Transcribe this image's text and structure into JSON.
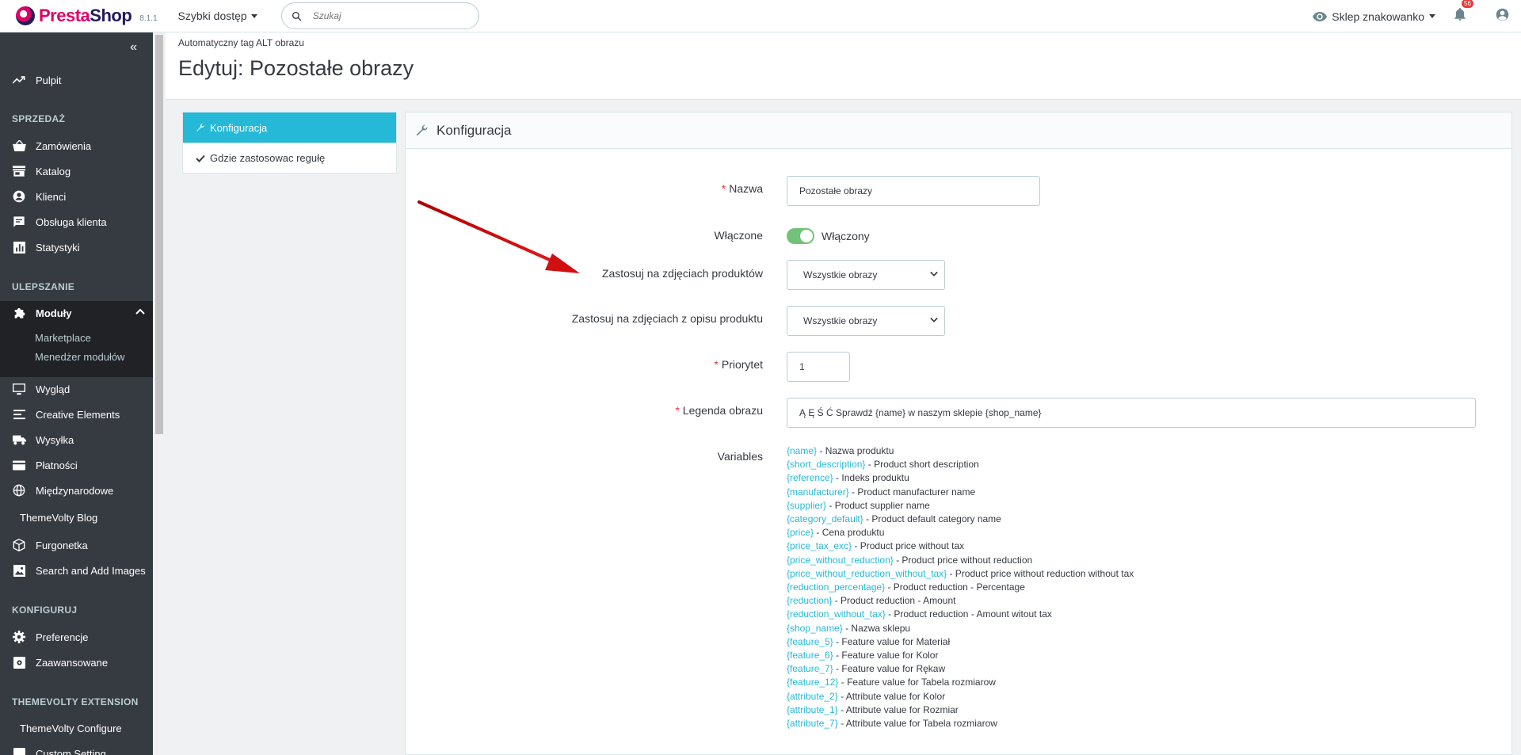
{
  "header": {
    "brand_part1": "Presta",
    "brand_part2": "Shop",
    "version": "8.1.1",
    "quick_access": "Szybki dostęp",
    "search_placeholder": "Szukaj",
    "shop_link": "Sklep znakowanko",
    "notifications_count": "56"
  },
  "sidebar": {
    "items": [
      {
        "label": "Pulpit",
        "icon": "trending-up-icon"
      },
      {
        "label": "Zamówienia",
        "icon": "basket-icon"
      },
      {
        "label": "Katalog",
        "icon": "store-icon"
      },
      {
        "label": "Klienci",
        "icon": "account-circle-icon"
      },
      {
        "label": "Obsługa klienta",
        "icon": "chat-icon"
      },
      {
        "label": "Statystyki",
        "icon": "bar-chart-icon"
      },
      {
        "label": "Moduły",
        "icon": "puzzle-icon"
      },
      {
        "label": "Wygląd",
        "icon": "desktop-icon"
      },
      {
        "label": "Creative Elements",
        "icon": "elements-icon"
      },
      {
        "label": "Wysyłka",
        "icon": "truck-icon"
      },
      {
        "label": "Płatności",
        "icon": "credit-card-icon"
      },
      {
        "label": "Międzynarodowe",
        "icon": "globe-icon"
      },
      {
        "label": "ThemeVolty Blog",
        "icon": ""
      },
      {
        "label": "Furgonetka",
        "icon": "box-icon"
      },
      {
        "label": "Search and Add Images",
        "icon": "image-icon"
      },
      {
        "label": "Preferencje",
        "icon": "gear-icon"
      },
      {
        "label": "Zaawansowane",
        "icon": "settings-box-icon"
      },
      {
        "label": "ThemeVolty Configure",
        "icon": ""
      },
      {
        "label": "Custom Setting",
        "icon": "custom-icon"
      }
    ],
    "sections": [
      "SPRZEDAŻ",
      "ULEPSZANIE",
      "KONFIGURUJ",
      "THEMEVOLTY EXTENSION"
    ],
    "module_sub": [
      "Marketplace",
      "Menedżer modułów"
    ]
  },
  "page": {
    "breadcrumb": "Automatyczny tag ALT obrazu",
    "title": "Edytuj: Pozostałe obrazy"
  },
  "tabs": [
    {
      "label": "Konfiguracja"
    },
    {
      "label": "Gdzie zastosowac regułę"
    }
  ],
  "panel": {
    "title": "Konfiguracja",
    "fields": {
      "name_label": "Nazwa",
      "name_value": "Pozostałe obrazy",
      "enabled_label": "Włączone",
      "enabled_value": "Włączony",
      "apply_products_label": "Zastosuj na zdjęciach produktów",
      "apply_products_value": "Wszystkie obrazy",
      "apply_desc_label": "Zastosuj na zdjęciach z opisu produktu",
      "apply_desc_value": "Wszystkie obrazy",
      "priority_label": "Priorytet",
      "priority_value": "1",
      "legend_label": "Legenda obrazu",
      "legend_value": "Ą Ę Ś Ć Sprawdź {name} w naszym sklepie {shop_name}",
      "variables_label": "Variables"
    },
    "variables": [
      {
        "tag": "{name}",
        "desc": " - Nazwa produktu"
      },
      {
        "tag": "{short_description}",
        "desc": " - Product short description"
      },
      {
        "tag": "{reference}",
        "desc": " - Indeks produktu"
      },
      {
        "tag": "{manufacturer}",
        "desc": " - Product manufacturer name"
      },
      {
        "tag": "{supplier}",
        "desc": " - Product supplier name"
      },
      {
        "tag": "{category_default}",
        "desc": " - Product default category name"
      },
      {
        "tag": "{price}",
        "desc": " - Cena produktu"
      },
      {
        "tag": "{price_tax_exc}",
        "desc": " - Product price without tax"
      },
      {
        "tag": "{price_without_reduction}",
        "desc": " - Product price without reduction"
      },
      {
        "tag": "{price_without_reduction_without_tax}",
        "desc": " - Product price without reduction without tax"
      },
      {
        "tag": "{reduction_percentage}",
        "desc": " - Product reduction - Percentage"
      },
      {
        "tag": "{reduction}",
        "desc": " - Product reduction - Amount"
      },
      {
        "tag": "{reduction_without_tax}",
        "desc": " - Product reduction - Amount witout tax"
      },
      {
        "tag": "{shop_name}",
        "desc": " - Nazwa sklepu"
      },
      {
        "tag": "{feature_5}",
        "desc": " - Feature value for Materiał"
      },
      {
        "tag": "{feature_6}",
        "desc": " - Feature value for Kolor"
      },
      {
        "tag": "{feature_7}",
        "desc": " - Feature value for Rękaw"
      },
      {
        "tag": "{feature_12}",
        "desc": " - Feature value for Tabela rozmiarow"
      },
      {
        "tag": "{attribute_2}",
        "desc": " - Attribute value for Kolor"
      },
      {
        "tag": "{attribute_1}",
        "desc": " - Attribute value for Rozmiar"
      },
      {
        "tag": "{attribute_7}",
        "desc": " - Attribute value for Tabela rozmiarow"
      }
    ]
  },
  "colors": {
    "accent": "#25b9d7",
    "sidebar": "#363a41",
    "toggle_on": "#72c279",
    "required": "#e43b3b",
    "annotation_arrow": "#d01010"
  }
}
